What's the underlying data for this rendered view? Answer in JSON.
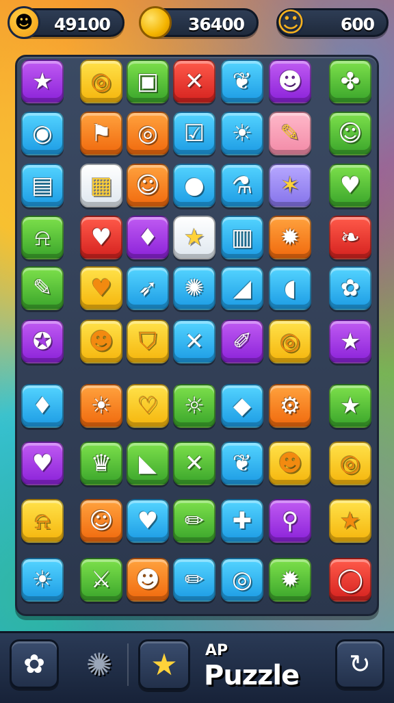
{
  "top_bar": {
    "stats": [
      {
        "name": "score",
        "icon": "smiley-face-icon",
        "value": "49100"
      },
      {
        "name": "coins",
        "icon": "gold-coin-icon",
        "value": "36400"
      },
      {
        "name": "lives",
        "icon": "ghost-creature-icon",
        "value": "600"
      }
    ]
  },
  "board": {
    "colors": {
      "purple": "#a93fe6",
      "yellow": "#fbc928",
      "green": "#55c23a",
      "red": "#e83a30",
      "blue": "#35b6f2",
      "orange": "#f5841f",
      "pink": "#f6a1b7",
      "lavender": "#9f8ef6",
      "white": "#f1f5f9"
    },
    "rows": [
      [
        {
          "c": "purple",
          "icon": "star-icon",
          "g": "★"
        },
        {
          "c": "yellow",
          "icon": "spiral-icon",
          "g": "◎"
        },
        {
          "c": "green",
          "icon": "box-icon",
          "g": "▣"
        },
        {
          "c": "red",
          "icon": "cross-icon",
          "g": "✕"
        },
        {
          "c": "blue",
          "icon": "leaf-icon",
          "g": "❦"
        },
        {
          "c": "purple",
          "icon": "flame-face-icon",
          "g": "☻"
        },
        {
          "c": "green",
          "icon": "swirl-icon",
          "g": "✤"
        }
      ],
      [
        {
          "c": "blue",
          "icon": "bubble-icon",
          "g": "◉"
        },
        {
          "c": "orange",
          "icon": "flag-icon",
          "g": "⚑"
        },
        {
          "c": "orange",
          "icon": "spiral-icon",
          "g": "◎"
        },
        {
          "c": "blue",
          "icon": "check-box-icon",
          "g": "☑"
        },
        {
          "c": "blue",
          "icon": "sun-face-icon",
          "g": "☀"
        },
        {
          "c": "pink",
          "icon": "pencil-icon",
          "g": "✎"
        },
        {
          "c": "green",
          "icon": "smiley-icon",
          "g": "☺"
        }
      ],
      [
        {
          "c": "blue",
          "icon": "book-icon",
          "g": "▤"
        },
        {
          "c": "white",
          "icon": "luggage-icon",
          "g": "▦"
        },
        {
          "c": "orange",
          "icon": "smiley-icon",
          "g": "☺"
        },
        {
          "c": "blue",
          "icon": "moon-face-icon",
          "g": "●"
        },
        {
          "c": "blue",
          "icon": "potion-icon",
          "g": "⚗"
        },
        {
          "c": "lavender",
          "icon": "star-fish-icon",
          "g": "✶"
        },
        {
          "c": "green",
          "icon": "heart-icon",
          "g": "♥"
        }
      ],
      [
        {
          "c": "green",
          "icon": "bell-icon",
          "g": "⍾"
        },
        {
          "c": "red",
          "icon": "heart-icon",
          "g": "♥"
        },
        {
          "c": "purple",
          "icon": "gem-heart-icon",
          "g": "♦"
        },
        {
          "c": "white",
          "icon": "star-icon",
          "g": "★"
        },
        {
          "c": "blue",
          "icon": "robot-icon",
          "g": "▥"
        },
        {
          "c": "orange",
          "icon": "virus-icon",
          "g": "✹"
        },
        {
          "c": "red",
          "icon": "leaf-icon",
          "g": "❧"
        }
      ],
      [
        {
          "c": "green",
          "icon": "pencil-icon",
          "g": "✎"
        },
        {
          "c": "yellow",
          "icon": "heart-icon",
          "g": "♥"
        },
        {
          "c": "blue",
          "icon": "rocket-icon",
          "g": "➶"
        },
        {
          "c": "blue",
          "icon": "germ-icon",
          "g": "✺"
        },
        {
          "c": "blue",
          "icon": "triangle-icon",
          "g": "◢"
        },
        {
          "c": "blue",
          "icon": "fish-icon",
          "g": "◖"
        },
        {
          "c": "blue",
          "icon": "flower-icon",
          "g": "✿"
        }
      ],
      [
        {
          "c": "purple",
          "icon": "swirl-icon",
          "g": "✪"
        },
        {
          "c": "yellow",
          "icon": "frog-icon",
          "g": "☻"
        },
        {
          "c": "yellow",
          "icon": "shield-icon",
          "g": "⛉"
        },
        {
          "c": "blue",
          "icon": "cross-icon",
          "g": "✕"
        },
        {
          "c": "purple",
          "icon": "pencil-icon",
          "g": "✐"
        },
        {
          "c": "yellow",
          "icon": "ring-icon",
          "g": "◎"
        },
        {
          "c": "purple",
          "icon": "star-icon",
          "g": "★"
        }
      ],
      [
        {
          "c": "blue",
          "icon": "gem-icon",
          "g": "♦"
        },
        {
          "c": "orange",
          "icon": "sun-face-icon",
          "g": "☀"
        },
        {
          "c": "yellow",
          "icon": "heart-icon",
          "g": "♡"
        },
        {
          "c": "green",
          "icon": "sun-icon",
          "g": "☼"
        },
        {
          "c": "blue",
          "icon": "crystal-icon",
          "g": "◆"
        },
        {
          "c": "orange",
          "icon": "gear-icon",
          "g": "⚙"
        },
        {
          "c": "green",
          "icon": "star-icon",
          "g": "★"
        }
      ],
      [
        {
          "c": "purple",
          "icon": "heart-icon",
          "g": "♥"
        },
        {
          "c": "green",
          "icon": "crown-star-icon",
          "g": "♛"
        },
        {
          "c": "green",
          "icon": "shark-icon",
          "g": "◣"
        },
        {
          "c": "green",
          "icon": "cross-icon",
          "g": "✕"
        },
        {
          "c": "blue",
          "icon": "leaf-icon",
          "g": "❦"
        },
        {
          "c": "yellow",
          "icon": "frog-icon",
          "g": "☻"
        },
        {
          "c": "yellow",
          "icon": "ring-icon",
          "g": "◎"
        }
      ],
      [
        {
          "c": "yellow",
          "icon": "bell-icon",
          "g": "⍾"
        },
        {
          "c": "orange",
          "icon": "bear-face-icon",
          "g": "☺"
        },
        {
          "c": "blue",
          "icon": "heart-icon",
          "g": "♥"
        },
        {
          "c": "green",
          "icon": "crayon-icon",
          "g": "✏"
        },
        {
          "c": "blue",
          "icon": "puzzle-piece-icon",
          "g": "✚"
        },
        {
          "c": "purple",
          "icon": "balloon-icon",
          "g": "⚲"
        },
        {
          "c": "yellow",
          "icon": "star-icon",
          "g": "★"
        }
      ],
      [
        {
          "c": "blue",
          "icon": "sun-face-icon",
          "g": "☀"
        },
        {
          "c": "green",
          "icon": "sword-icon",
          "g": "⚔"
        },
        {
          "c": "orange",
          "icon": "blob-face-icon",
          "g": "☻"
        },
        {
          "c": "blue",
          "icon": "crayon-icon",
          "g": "✏"
        },
        {
          "c": "blue",
          "icon": "spiral-icon",
          "g": "◎"
        },
        {
          "c": "green",
          "icon": "virus-icon",
          "g": "✹"
        },
        {
          "c": "red",
          "icon": "ring-icon",
          "g": "◯"
        }
      ]
    ]
  },
  "bottom_bar": {
    "title_small": "AP",
    "title_big": "Puzzle",
    "buttons": [
      {
        "name": "settings-button",
        "icon": "gear-blob-icon",
        "g": "✿"
      },
      {
        "name": "booster-button",
        "icon": "spiky-ball-icon",
        "g": "✺"
      },
      {
        "name": "star-button",
        "icon": "star-face-icon",
        "g": "★"
      },
      {
        "name": "restart-button",
        "icon": "restart-arrow-icon",
        "g": "↻"
      }
    ]
  }
}
